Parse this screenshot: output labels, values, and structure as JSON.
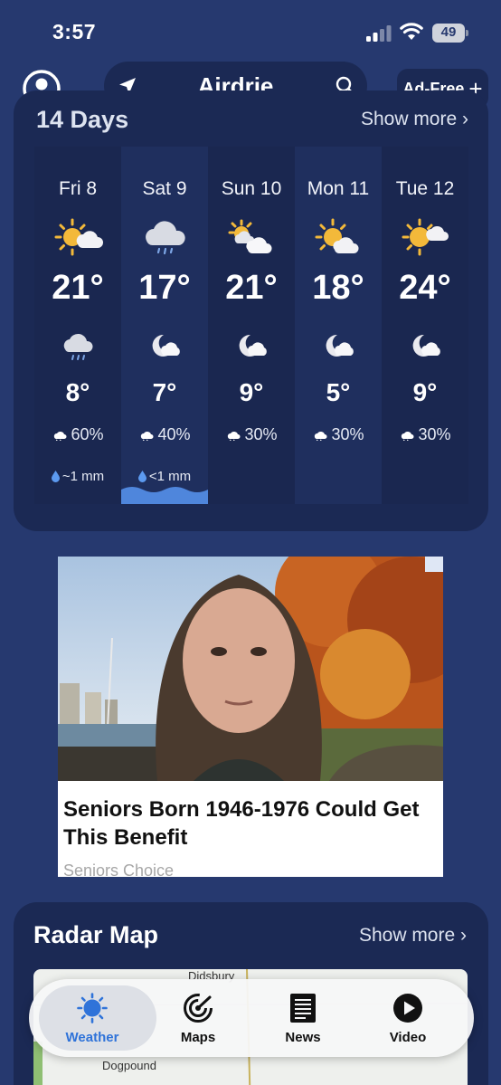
{
  "status_bar": {
    "time": "3:57",
    "battery": "49"
  },
  "header": {
    "location": "Airdrie",
    "ad_free_label": "Ad-Free"
  },
  "forecast": {
    "title": "14 Days",
    "show_more": "Show more",
    "days": [
      {
        "name": "Fri 8",
        "day_icon": "sun-cloud-icon",
        "high": "21°",
        "night_icon": "cloud-rain-icon",
        "low": "8°",
        "precip": "60%",
        "rain": "~1 mm"
      },
      {
        "name": "Sat 9",
        "day_icon": "cloud-rain-icon",
        "high": "17°",
        "night_icon": "moon-cloud-icon",
        "low": "7°",
        "precip": "40%",
        "rain": "<1 mm"
      },
      {
        "name": "Sun 10",
        "day_icon": "sun-clouds-icon",
        "high": "21°",
        "night_icon": "moon-cloud-icon",
        "low": "9°",
        "precip": "30%",
        "rain": ""
      },
      {
        "name": "Mon 11",
        "day_icon": "sun-cloud-icon",
        "high": "18°",
        "night_icon": "moon-cloud-icon",
        "low": "5°",
        "precip": "30%",
        "rain": ""
      },
      {
        "name": "Tue 12",
        "day_icon": "sun-cloud-icon",
        "high": "24°",
        "night_icon": "moon-cloud-icon",
        "low": "9°",
        "precip": "30%",
        "rain": ""
      }
    ]
  },
  "ad": {
    "headline": "Seniors Born 1946-1976 Could Get This Benefit",
    "sponsor": "Seniors Choice"
  },
  "radar": {
    "title": "Radar Map",
    "show_more": "Show more",
    "map_labels": [
      "Didsbury",
      "Dogpound"
    ]
  },
  "tabs": [
    {
      "label": "Weather",
      "icon": "sun-icon"
    },
    {
      "label": "Maps",
      "icon": "radar-icon"
    },
    {
      "label": "News",
      "icon": "newspaper-icon"
    },
    {
      "label": "Video",
      "icon": "play-icon"
    }
  ],
  "colors": {
    "background": "#26396f",
    "card": "#1b2954",
    "accent": "#2f73d9",
    "water": "#4f86dc"
  }
}
